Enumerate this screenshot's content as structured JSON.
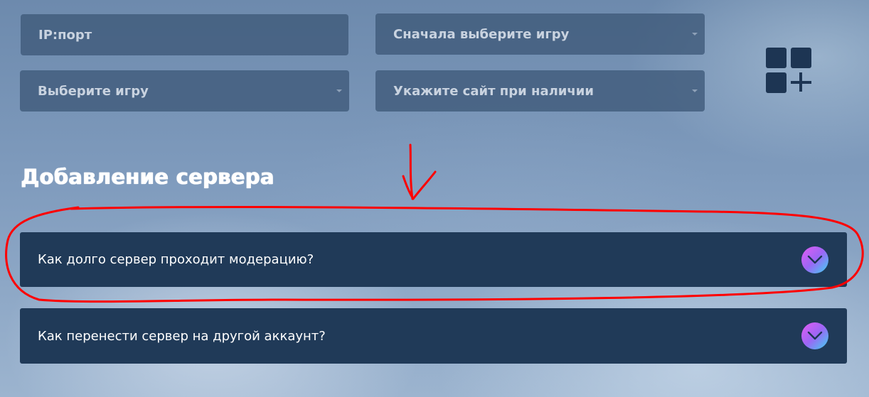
{
  "form": {
    "ip_port_placeholder": "IP:порт",
    "game_mode_placeholder": "Сначала выберите игру",
    "game_placeholder": "Выберите игру",
    "site_placeholder": "Укажите сайт при наличии"
  },
  "add_button": {
    "icon": "add-grid-icon"
  },
  "section": {
    "title": "Добавление сервера"
  },
  "faq": [
    {
      "question": "Как долго сервер проходит модерацию?",
      "icon": "chevron-down-icon"
    },
    {
      "question": "Как перенести сервер на другой аккаунт?",
      "icon": "chevron-down-icon"
    }
  ],
  "colors": {
    "field_bg": "#3e5878",
    "faq_bg": "#203a58",
    "accent_gradient_start": "#e45cf2",
    "accent_gradient_end": "#3fd3f2",
    "annotation": "#ff0000"
  }
}
